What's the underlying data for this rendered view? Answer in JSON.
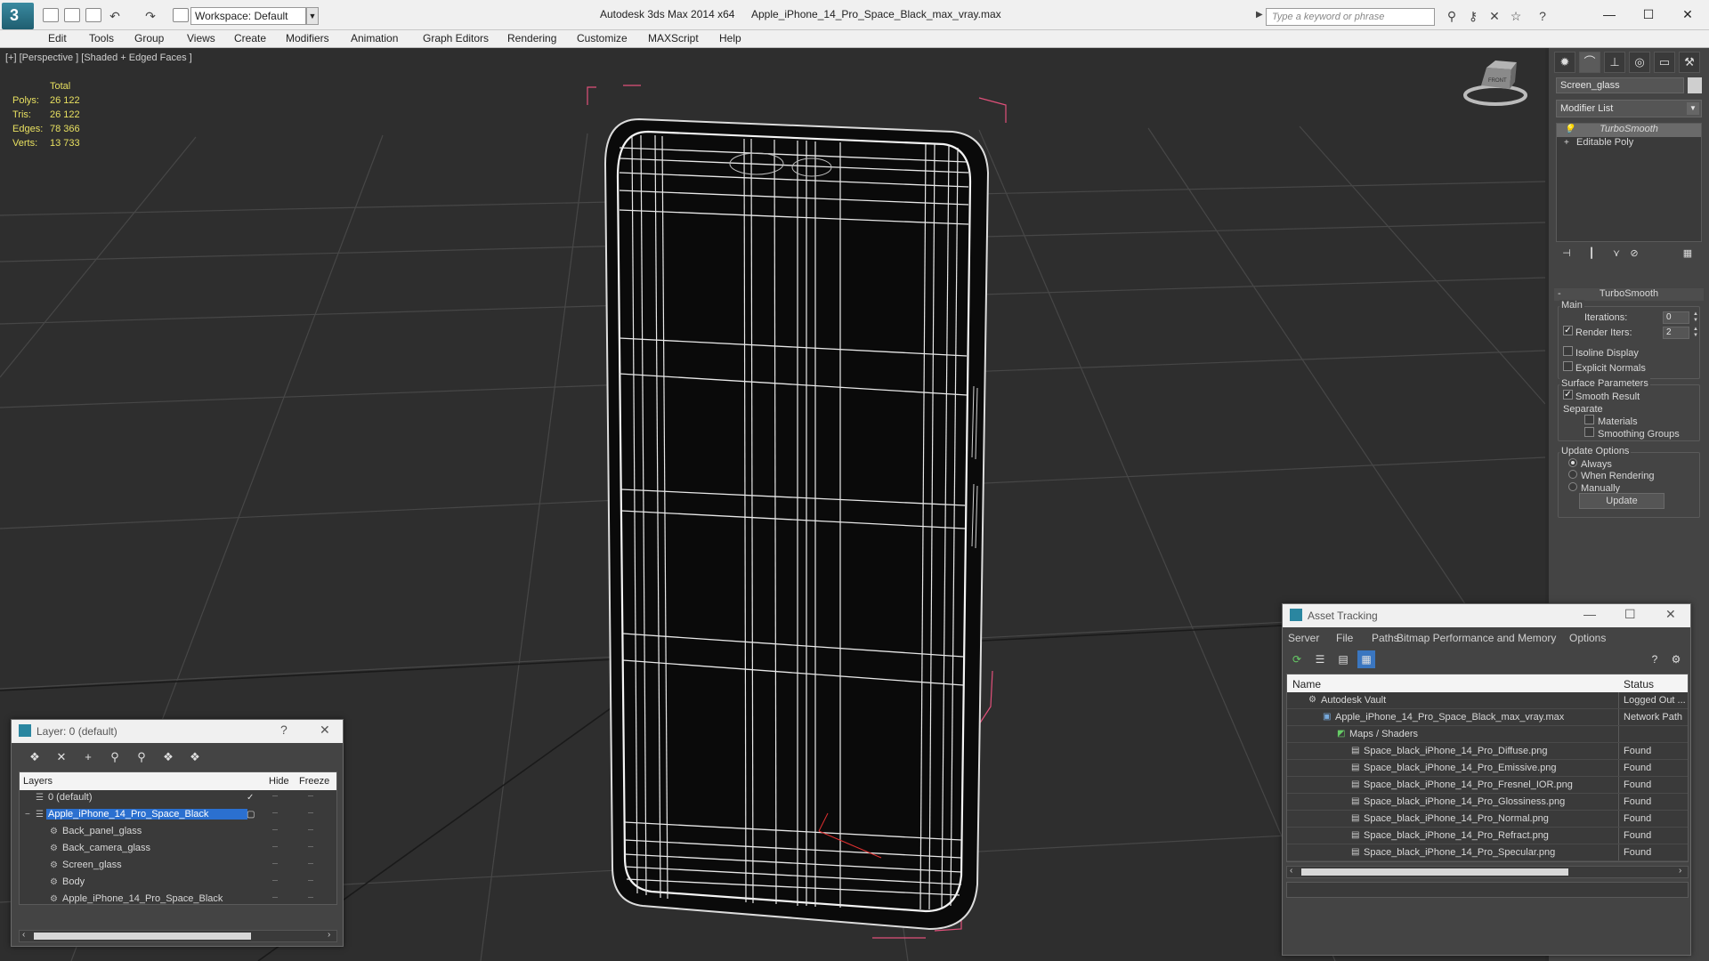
{
  "window": {
    "app_title": "Autodesk 3ds Max  2014 x64",
    "file_title": "Apple_iPhone_14_Pro_Space_Black_max_vray.max",
    "workspace": "Workspace: Default",
    "search_placeholder": "Type a keyword or phrase"
  },
  "menu": [
    "Edit",
    "Tools",
    "Group",
    "Views",
    "Create",
    "Modifiers",
    "Animation",
    "Graph Editors",
    "Rendering",
    "Customize",
    "MAXScript",
    "Help"
  ],
  "viewport": {
    "label": "[+] [Perspective ] [Shaded + Edged Faces ]",
    "stats_header": "Total",
    "stats": [
      {
        "label": "Polys:",
        "value": "26 122"
      },
      {
        "label": "Tris:",
        "value": "26 122"
      },
      {
        "label": "Edges:",
        "value": "78 366"
      },
      {
        "label": "Verts:",
        "value": "13 733"
      }
    ],
    "viewcube_label": "FRONT"
  },
  "command_panel": {
    "object_name": "Screen_glass",
    "modifier_list": "Modifier List",
    "stack": [
      "TurboSmooth",
      "Editable Poly"
    ],
    "rollout_title": "TurboSmooth",
    "main_label": "Main",
    "iterations_label": "Iterations:",
    "iterations_value": "0",
    "render_iters_label": "Render Iters:",
    "render_iters_value": "2",
    "render_iters_checked": true,
    "isoline_label": "Isoline Display",
    "explicit_normals_label": "Explicit Normals",
    "surface_params_label": "Surface Parameters",
    "smooth_result_label": "Smooth Result",
    "separate_label": "Separate",
    "materials_label": "Materials",
    "smoothing_groups_label": "Smoothing Groups",
    "update_options_label": "Update Options",
    "always_label": "Always",
    "when_rendering_label": "When Rendering",
    "manually_label": "Manually",
    "update_button": "Update"
  },
  "layer_window": {
    "title": "Layer: 0 (default)",
    "help": "?",
    "columns": {
      "layers": "Layers",
      "hide": "Hide",
      "freeze": "Freeze"
    },
    "rows": [
      {
        "name": "0 (default)",
        "indent": 0,
        "selected": false,
        "current": true
      },
      {
        "name": "Apple_iPhone_14_Pro_Space_Black",
        "indent": 0,
        "selected": true,
        "current": false
      },
      {
        "name": "Back_panel_glass",
        "indent": 1,
        "selected": false,
        "current": false
      },
      {
        "name": "Back_camera_glass",
        "indent": 1,
        "selected": false,
        "current": false
      },
      {
        "name": "Screen_glass",
        "indent": 1,
        "selected": false,
        "current": false
      },
      {
        "name": "Body",
        "indent": 1,
        "selected": false,
        "current": false
      },
      {
        "name": "Apple_iPhone_14_Pro_Space_Black",
        "indent": 1,
        "selected": false,
        "current": false
      }
    ]
  },
  "asset_window": {
    "title": "Asset Tracking",
    "menu": [
      "Server",
      "File",
      "Paths",
      "Bitmap Performance and Memory",
      "Options"
    ],
    "columns": {
      "name": "Name",
      "status": "Status"
    },
    "rows": [
      {
        "name": "Autodesk Vault",
        "status": "Logged Out ...",
        "indent": 1
      },
      {
        "name": "Apple_iPhone_14_Pro_Space_Black_max_vray.max",
        "status": "Network Path",
        "indent": 2
      },
      {
        "name": "Maps / Shaders",
        "status": "",
        "indent": 3
      },
      {
        "name": "Space_black_iPhone_14_Pro_Diffuse.png",
        "status": "Found",
        "indent": 4
      },
      {
        "name": "Space_black_iPhone_14_Pro_Emissive.png",
        "status": "Found",
        "indent": 4
      },
      {
        "name": "Space_black_iPhone_14_Pro_Fresnel_IOR.png",
        "status": "Found",
        "indent": 4
      },
      {
        "name": "Space_black_iPhone_14_Pro_Glossiness.png",
        "status": "Found",
        "indent": 4
      },
      {
        "name": "Space_black_iPhone_14_Pro_Normal.png",
        "status": "Found",
        "indent": 4
      },
      {
        "name": "Space_black_iPhone_14_Pro_Refract.png",
        "status": "Found",
        "indent": 4
      },
      {
        "name": "Space_black_iPhone_14_Pro_Specular.png",
        "status": "Found",
        "indent": 4
      }
    ]
  }
}
